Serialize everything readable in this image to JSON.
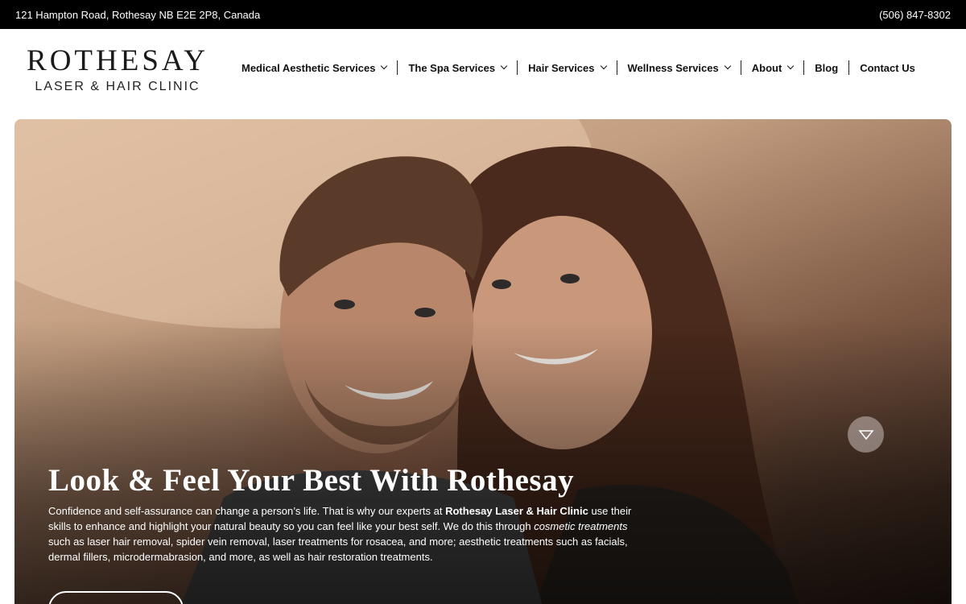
{
  "topbar": {
    "address": "121 Hampton Road, Rothesay NB E2E 2P8, Canada",
    "phone": "(506) 847-8302"
  },
  "logo": {
    "main": "ROTHESAY",
    "sub": "LASER & HAIR CLINIC"
  },
  "nav": {
    "items": [
      {
        "label": "Medical Aesthetic Services",
        "dropdown": true
      },
      {
        "label": "The Spa Services",
        "dropdown": true
      },
      {
        "label": "Hair Services",
        "dropdown": true
      },
      {
        "label": "Wellness Services",
        "dropdown": true
      },
      {
        "label": "About",
        "dropdown": true
      },
      {
        "label": "Blog",
        "dropdown": false
      },
      {
        "label": "Contact Us",
        "dropdown": false
      }
    ]
  },
  "hero": {
    "title": "Look & Feel Your Best With Rothesay",
    "text_1": "Confidence and self-assurance can change a person’s life. That is why our experts at ",
    "text_bold": "Rothesay Laser & Hair Clinic",
    "text_2": " use their skills to enhance and highlight your natural beauty so you can feel like your best self. We do this through ",
    "text_italic": "cosmetic treatments",
    "text_3": " such as laser hair removal, spider vein removal, laser treatments for rosacea, and more; aesthetic treatments such as facials, dermal fillers, microdermabrasion, and more, as well as hair restoration treatments.",
    "scroll_icon": "triangle-down-icon"
  }
}
